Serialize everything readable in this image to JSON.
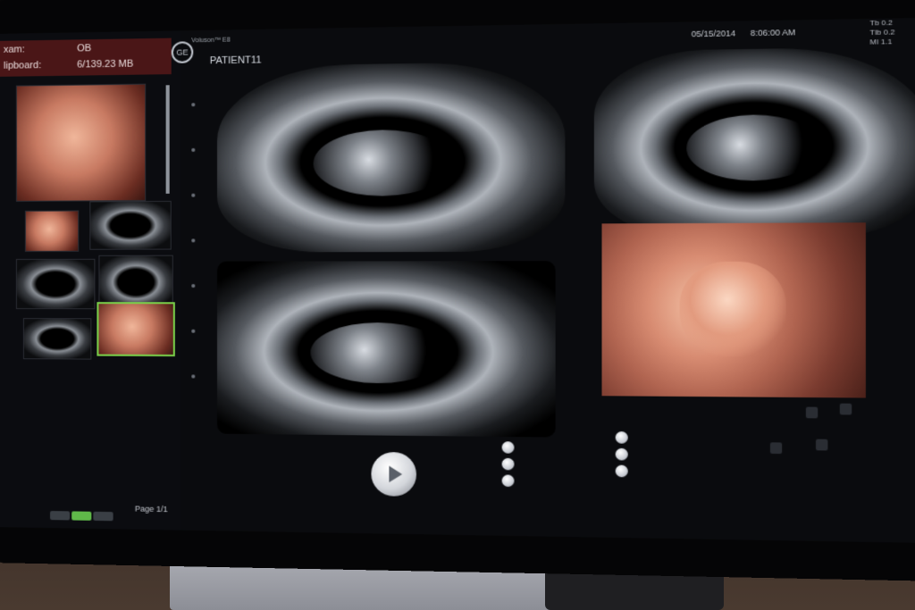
{
  "header": {
    "exam_label": "xam:",
    "exam_value": "OB",
    "clipboard_label": "lipboard:",
    "clipboard_value": "6/139.23 MB"
  },
  "brand": {
    "logo": "GE",
    "product": "Voluson™ E8"
  },
  "patient": {
    "name": "PATIENT11"
  },
  "datetime": {
    "date": "05/15/2014",
    "time": "8:06:00 AM"
  },
  "readout": {
    "line1": "Tb 0.2",
    "line2": "TIb 0.2",
    "line3": "MI 1.1"
  },
  "footer": {
    "page": "Page 1/1"
  },
  "icons": {
    "play": "play-icon",
    "logo": "ge-logo-icon"
  },
  "colors": {
    "header_bg": "#4a1617",
    "selected_thumb": "#7ad04a",
    "active_tab": "#5fb849"
  }
}
